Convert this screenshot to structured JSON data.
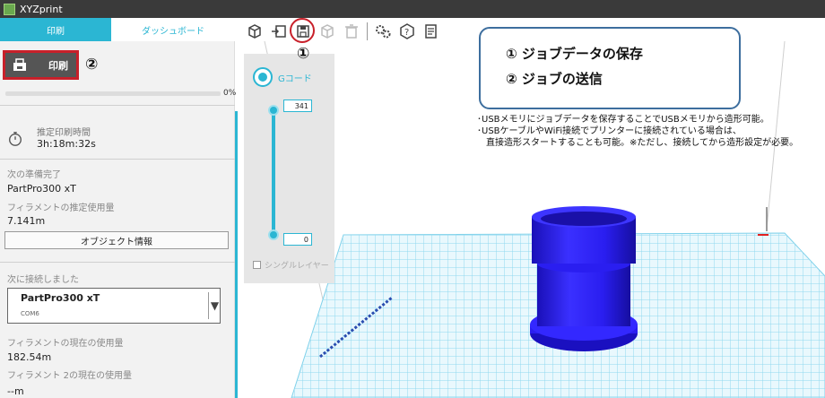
{
  "window": {
    "title": "XYZprint"
  },
  "tabs": [
    {
      "label": "印刷"
    },
    {
      "label": "ダッシュボード"
    }
  ],
  "toolbar": {
    "icons": [
      "import-model-icon",
      "export-icon",
      "save-job-icon",
      "cube-icon",
      "delete-icon",
      "settings-icon",
      "help-icon",
      "printer-settings-icon"
    ]
  },
  "callouts": {
    "num1": "①",
    "num2": "②",
    "box": {
      "line1": "① ジョブデータの保存",
      "line2": "② ジョブの送信"
    },
    "notes": [
      "･USBメモリにジョブデータを保存することでUSBメモリから造形可能。",
      "･USBケーブルやWiFi接続でプリンターに接続されている場合は、",
      "　直接造形スタートすることも可能。※ただし、接続してから造形設定が必要。"
    ]
  },
  "left_panel": {
    "print_button": "印刷",
    "progress_percent": "0%",
    "progress_value": 0,
    "estimated_time_label": "推定印刷時間",
    "estimated_time_value": "3h:18m:32s",
    "next_ready_label": "次の準備完了",
    "next_ready_printer": "PartPro300 xT",
    "filament_estimated_label": "フィラメントの推定使用量",
    "filament_estimated_value": "7.141m",
    "object_info_button": "オブジェクト情報",
    "connected_label": "次に接続しました",
    "printer_name": "PartPro300 xT",
    "printer_port": "COM6",
    "filament_current_label": "フィラメントの現在の使用量",
    "filament_current_value": "182.54m",
    "filament2_current_label": "フィラメント 2の現在の使用量",
    "filament2_current_value": "--m"
  },
  "layer_panel": {
    "gcode_label": "Gコード",
    "top_value": "341",
    "bottom_value": "0",
    "single_layer_label": "シングルレイヤー"
  },
  "colors": {
    "accent": "#2bb6d3",
    "highlight": "#c8202a",
    "model": "#2a1ef0",
    "grid": "#8fd8ee"
  }
}
